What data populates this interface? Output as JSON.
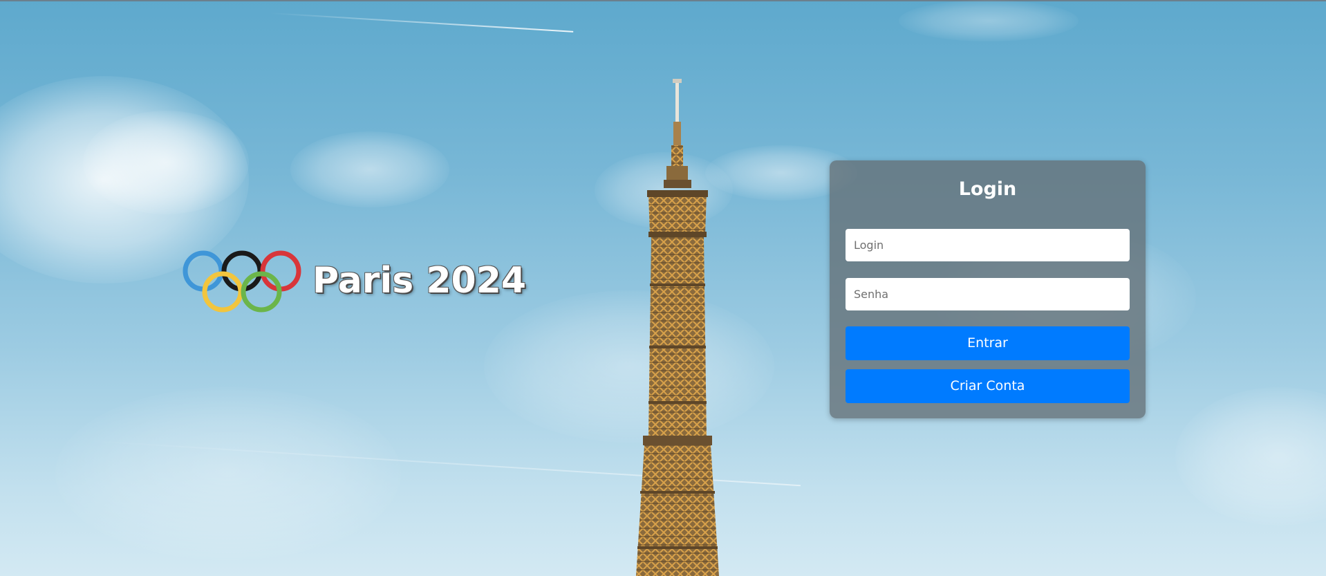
{
  "brand": {
    "title": "Paris 2024",
    "ring_colors": [
      "#3f96d8",
      "#1a1a1a",
      "#d8353a",
      "#f2c53d",
      "#6bb54a"
    ]
  },
  "login_form": {
    "title": "Login",
    "login_placeholder": "Login",
    "password_placeholder": "Senha",
    "submit_label": "Entrar",
    "create_account_label": "Criar Conta",
    "button_color": "#007bff"
  }
}
